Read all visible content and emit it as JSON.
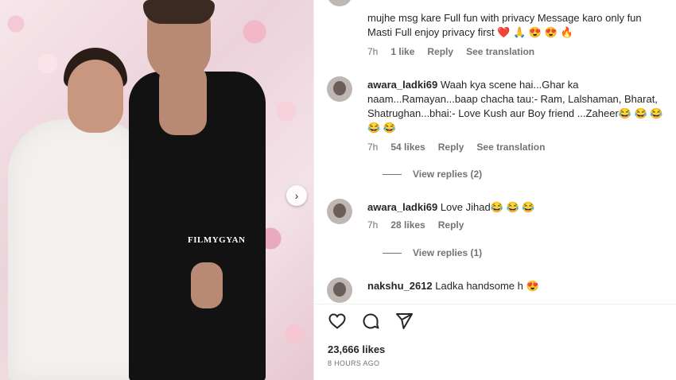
{
  "photo": {
    "watermark": "FILMYGYAN",
    "next_icon": "chevron-right-icon"
  },
  "comments": [
    {
      "text_line1": "mujhe msg kare Full fun with privacy Message karo only fun",
      "text_line2": "Masti Full enjoy privacy first",
      "emojis": "❤️ 🙏 😍 😍 🔥",
      "time": "7h",
      "likes": "1 like",
      "reply": "Reply",
      "see_translation": "See translation"
    },
    {
      "username": "awara_ladki69",
      "text": "Waah kya scene hai...Ghar ka naam...Ramayan...baap chacha tau:- Ram, Lalshaman, Bharat, Shatrughan...bhai:- Love Kush aur Boy friend ...Zaheer😂 😂 😂 😂 😂",
      "time": "7h",
      "likes": "54 likes",
      "reply": "Reply",
      "see_translation": "See translation",
      "view_replies": "View replies (2)"
    },
    {
      "username": "awara_ladki69",
      "text": "Love Jihad😂 😂 😂",
      "time": "7h",
      "likes": "28 likes",
      "reply": "Reply",
      "view_replies": "View replies (1)"
    },
    {
      "username": "nakshu_2612",
      "text": "Ladka handsome h 😍"
    }
  ],
  "actions": {
    "like_icon": "heart-icon",
    "comment_icon": "comment-icon",
    "share_icon": "send-icon"
  },
  "post": {
    "likes": "23,666 likes",
    "time_ago": "8 HOURS AGO"
  }
}
